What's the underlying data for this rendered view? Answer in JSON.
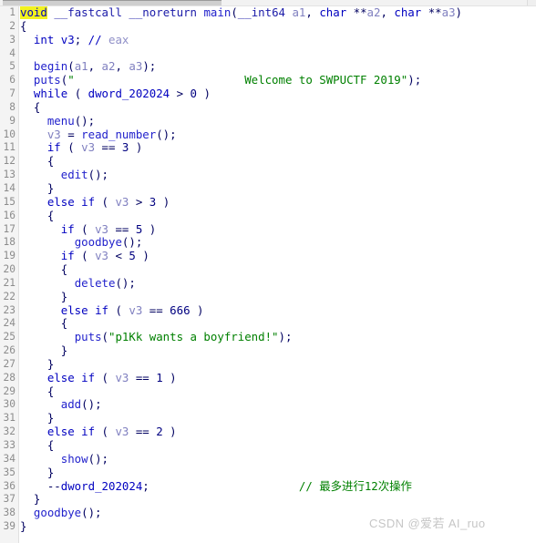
{
  "window": {
    "title": "IDA Pseudocode View",
    "background": "#ffffff"
  },
  "scrollbar": {
    "orientation": "horizontal",
    "thumb_label": "",
    "corner_label": ""
  },
  "colors": {
    "keyword": "#0000c0",
    "function": "#2222cc",
    "variable": "#8080c0",
    "string": "#008000",
    "comment": "#9090c8",
    "comment_green": "#008000",
    "highlight": "#f2f21e",
    "gutter_bg": "#f4f4f4",
    "line_number": "#8c8c8c",
    "watermark": "#c6c6c6"
  },
  "editor": {
    "first_line": 1,
    "last_line": 39,
    "total_lines": 39,
    "line_numbers": [
      1,
      2,
      3,
      4,
      5,
      6,
      7,
      8,
      9,
      10,
      11,
      12,
      13,
      14,
      15,
      16,
      17,
      18,
      19,
      20,
      21,
      22,
      23,
      24,
      25,
      26,
      27,
      28,
      29,
      30,
      31,
      32,
      33,
      34,
      35,
      36,
      37,
      38,
      39
    ],
    "highlighted_token": "void",
    "lines": [
      {
        "n": 1,
        "text": "void __fastcall __noreturn main(__int64 a1, char **a2, char **a3)",
        "tokens": [
          {
            "t": "void",
            "c": "hl-find"
          },
          {
            "t": " ",
            "c": "t-plain"
          },
          {
            "t": "__fastcall",
            "c": "t-kw2"
          },
          {
            "t": " ",
            "c": "t-plain"
          },
          {
            "t": "__noreturn",
            "c": "t-kw2"
          },
          {
            "t": " ",
            "c": "t-plain"
          },
          {
            "t": "main",
            "c": "t-fn"
          },
          {
            "t": "(",
            "c": "t-punc"
          },
          {
            "t": "__int64",
            "c": "t-kw2"
          },
          {
            "t": " ",
            "c": "t-plain"
          },
          {
            "t": "a1",
            "c": "t-var"
          },
          {
            "t": ", ",
            "c": "t-punc"
          },
          {
            "t": "char",
            "c": "t-kw"
          },
          {
            "t": " **",
            "c": "t-punc"
          },
          {
            "t": "a2",
            "c": "t-var"
          },
          {
            "t": ", ",
            "c": "t-punc"
          },
          {
            "t": "char",
            "c": "t-kw"
          },
          {
            "t": " **",
            "c": "t-punc"
          },
          {
            "t": "a3",
            "c": "t-var"
          },
          {
            "t": ")",
            "c": "t-punc"
          }
        ]
      },
      {
        "n": 2,
        "text": "{",
        "tokens": [
          {
            "t": "{",
            "c": "t-punc"
          }
        ]
      },
      {
        "n": 3,
        "text": "  int v3; // eax",
        "tokens": [
          {
            "t": "  ",
            "c": "t-plain"
          },
          {
            "t": "int",
            "c": "t-kw"
          },
          {
            "t": " ",
            "c": "t-plain"
          },
          {
            "t": "v3",
            "c": "t-kw"
          },
          {
            "t": "; ",
            "c": "t-punc"
          },
          {
            "t": "// ",
            "c": "t-kw"
          },
          {
            "t": "eax",
            "c": "t-cmt"
          }
        ]
      },
      {
        "n": 4,
        "text": "",
        "tokens": []
      },
      {
        "n": 5,
        "text": "  begin(a1, a2, a3);",
        "tokens": [
          {
            "t": "  ",
            "c": "t-plain"
          },
          {
            "t": "begin",
            "c": "t-fn"
          },
          {
            "t": "(",
            "c": "t-punc"
          },
          {
            "t": "a1",
            "c": "t-var"
          },
          {
            "t": ", ",
            "c": "t-punc"
          },
          {
            "t": "a2",
            "c": "t-var"
          },
          {
            "t": ", ",
            "c": "t-punc"
          },
          {
            "t": "a3",
            "c": "t-var"
          },
          {
            "t": ");",
            "c": "t-punc"
          }
        ]
      },
      {
        "n": 6,
        "text": "  puts(\"                         Welcome to SWPUCTF 2019\");",
        "tokens": [
          {
            "t": "  ",
            "c": "t-plain"
          },
          {
            "t": "puts",
            "c": "t-fn"
          },
          {
            "t": "(",
            "c": "t-punc"
          },
          {
            "t": "\"                         Welcome to SWPUCTF 2019\"",
            "c": "t-str"
          },
          {
            "t": ");",
            "c": "t-punc"
          }
        ]
      },
      {
        "n": 7,
        "text": "  while ( dword_202024 > 0 )",
        "tokens": [
          {
            "t": "  ",
            "c": "t-plain"
          },
          {
            "t": "while",
            "c": "t-kw"
          },
          {
            "t": " ( ",
            "c": "t-punc"
          },
          {
            "t": "dword_202024",
            "c": "t-kw"
          },
          {
            "t": " > ",
            "c": "t-punc"
          },
          {
            "t": "0",
            "c": "t-num"
          },
          {
            "t": " )",
            "c": "t-punc"
          }
        ]
      },
      {
        "n": 8,
        "text": "  {",
        "tokens": [
          {
            "t": "  {",
            "c": "t-punc"
          }
        ]
      },
      {
        "n": 9,
        "text": "    menu();",
        "tokens": [
          {
            "t": "    ",
            "c": "t-plain"
          },
          {
            "t": "menu",
            "c": "t-fn"
          },
          {
            "t": "();",
            "c": "t-punc"
          }
        ]
      },
      {
        "n": 10,
        "text": "    v3 = read_number();",
        "tokens": [
          {
            "t": "    ",
            "c": "t-plain"
          },
          {
            "t": "v3",
            "c": "t-var"
          },
          {
            "t": " = ",
            "c": "t-punc"
          },
          {
            "t": "read_number",
            "c": "t-fn"
          },
          {
            "t": "();",
            "c": "t-punc"
          }
        ]
      },
      {
        "n": 11,
        "text": "    if ( v3 == 3 )",
        "tokens": [
          {
            "t": "    ",
            "c": "t-plain"
          },
          {
            "t": "if",
            "c": "t-kw"
          },
          {
            "t": " ( ",
            "c": "t-punc"
          },
          {
            "t": "v3",
            "c": "t-var"
          },
          {
            "t": " == ",
            "c": "t-punc"
          },
          {
            "t": "3",
            "c": "t-num"
          },
          {
            "t": " )",
            "c": "t-punc"
          }
        ]
      },
      {
        "n": 12,
        "text": "    {",
        "tokens": [
          {
            "t": "    {",
            "c": "t-punc"
          }
        ]
      },
      {
        "n": 13,
        "text": "      edit();",
        "tokens": [
          {
            "t": "      ",
            "c": "t-plain"
          },
          {
            "t": "edit",
            "c": "t-fn"
          },
          {
            "t": "();",
            "c": "t-punc"
          }
        ]
      },
      {
        "n": 14,
        "text": "    }",
        "tokens": [
          {
            "t": "    }",
            "c": "t-punc"
          }
        ]
      },
      {
        "n": 15,
        "text": "    else if ( v3 > 3 )",
        "tokens": [
          {
            "t": "    ",
            "c": "t-plain"
          },
          {
            "t": "else",
            "c": "t-kw"
          },
          {
            "t": " ",
            "c": "t-plain"
          },
          {
            "t": "if",
            "c": "t-kw"
          },
          {
            "t": " ( ",
            "c": "t-punc"
          },
          {
            "t": "v3",
            "c": "t-var"
          },
          {
            "t": " > ",
            "c": "t-punc"
          },
          {
            "t": "3",
            "c": "t-num"
          },
          {
            "t": " )",
            "c": "t-punc"
          }
        ]
      },
      {
        "n": 16,
        "text": "    {",
        "tokens": [
          {
            "t": "    {",
            "c": "t-punc"
          }
        ]
      },
      {
        "n": 17,
        "text": "      if ( v3 == 5 )",
        "tokens": [
          {
            "t": "      ",
            "c": "t-plain"
          },
          {
            "t": "if",
            "c": "t-kw"
          },
          {
            "t": " ( ",
            "c": "t-punc"
          },
          {
            "t": "v3",
            "c": "t-var"
          },
          {
            "t": " == ",
            "c": "t-punc"
          },
          {
            "t": "5",
            "c": "t-num"
          },
          {
            "t": " )",
            "c": "t-punc"
          }
        ]
      },
      {
        "n": 18,
        "text": "        goodbye();",
        "tokens": [
          {
            "t": "        ",
            "c": "t-plain"
          },
          {
            "t": "goodbye",
            "c": "t-fn"
          },
          {
            "t": "();",
            "c": "t-punc"
          }
        ]
      },
      {
        "n": 19,
        "text": "      if ( v3 < 5 )",
        "tokens": [
          {
            "t": "      ",
            "c": "t-plain"
          },
          {
            "t": "if",
            "c": "t-kw"
          },
          {
            "t": " ( ",
            "c": "t-punc"
          },
          {
            "t": "v3",
            "c": "t-var"
          },
          {
            "t": " < ",
            "c": "t-punc"
          },
          {
            "t": "5",
            "c": "t-num"
          },
          {
            "t": " )",
            "c": "t-punc"
          }
        ]
      },
      {
        "n": 20,
        "text": "      {",
        "tokens": [
          {
            "t": "      {",
            "c": "t-punc"
          }
        ]
      },
      {
        "n": 21,
        "text": "        delete();",
        "tokens": [
          {
            "t": "        ",
            "c": "t-plain"
          },
          {
            "t": "delete",
            "c": "t-fn"
          },
          {
            "t": "();",
            "c": "t-punc"
          }
        ]
      },
      {
        "n": 22,
        "text": "      }",
        "tokens": [
          {
            "t": "      }",
            "c": "t-punc"
          }
        ]
      },
      {
        "n": 23,
        "text": "      else if ( v3 == 666 )",
        "tokens": [
          {
            "t": "      ",
            "c": "t-plain"
          },
          {
            "t": "else",
            "c": "t-kw"
          },
          {
            "t": " ",
            "c": "t-plain"
          },
          {
            "t": "if",
            "c": "t-kw"
          },
          {
            "t": " ( ",
            "c": "t-punc"
          },
          {
            "t": "v3",
            "c": "t-var"
          },
          {
            "t": " == ",
            "c": "t-punc"
          },
          {
            "t": "666",
            "c": "t-num"
          },
          {
            "t": " )",
            "c": "t-punc"
          }
        ]
      },
      {
        "n": 24,
        "text": "      {",
        "tokens": [
          {
            "t": "      {",
            "c": "t-punc"
          }
        ]
      },
      {
        "n": 25,
        "text": "        puts(\"p1Kk wants a boyfriend!\");",
        "tokens": [
          {
            "t": "        ",
            "c": "t-plain"
          },
          {
            "t": "puts",
            "c": "t-fn"
          },
          {
            "t": "(",
            "c": "t-punc"
          },
          {
            "t": "\"p1Kk wants a boyfriend!\"",
            "c": "t-str"
          },
          {
            "t": ");",
            "c": "t-punc"
          }
        ]
      },
      {
        "n": 26,
        "text": "      }",
        "tokens": [
          {
            "t": "      }",
            "c": "t-punc"
          }
        ]
      },
      {
        "n": 27,
        "text": "    }",
        "tokens": [
          {
            "t": "    }",
            "c": "t-punc"
          }
        ]
      },
      {
        "n": 28,
        "text": "    else if ( v3 == 1 )",
        "tokens": [
          {
            "t": "    ",
            "c": "t-plain"
          },
          {
            "t": "else",
            "c": "t-kw"
          },
          {
            "t": " ",
            "c": "t-plain"
          },
          {
            "t": "if",
            "c": "t-kw"
          },
          {
            "t": " ( ",
            "c": "t-punc"
          },
          {
            "t": "v3",
            "c": "t-var"
          },
          {
            "t": " == ",
            "c": "t-punc"
          },
          {
            "t": "1",
            "c": "t-num"
          },
          {
            "t": " )",
            "c": "t-punc"
          }
        ]
      },
      {
        "n": 29,
        "text": "    {",
        "tokens": [
          {
            "t": "    {",
            "c": "t-punc"
          }
        ]
      },
      {
        "n": 30,
        "text": "      add();",
        "tokens": [
          {
            "t": "      ",
            "c": "t-plain"
          },
          {
            "t": "add",
            "c": "t-fn"
          },
          {
            "t": "();",
            "c": "t-punc"
          }
        ]
      },
      {
        "n": 31,
        "text": "    }",
        "tokens": [
          {
            "t": "    }",
            "c": "t-punc"
          }
        ]
      },
      {
        "n": 32,
        "text": "    else if ( v3 == 2 )",
        "tokens": [
          {
            "t": "    ",
            "c": "t-plain"
          },
          {
            "t": "else",
            "c": "t-kw"
          },
          {
            "t": " ",
            "c": "t-plain"
          },
          {
            "t": "if",
            "c": "t-kw"
          },
          {
            "t": " ( ",
            "c": "t-punc"
          },
          {
            "t": "v3",
            "c": "t-var"
          },
          {
            "t": " == ",
            "c": "t-punc"
          },
          {
            "t": "2",
            "c": "t-num"
          },
          {
            "t": " )",
            "c": "t-punc"
          }
        ]
      },
      {
        "n": 33,
        "text": "    {",
        "tokens": [
          {
            "t": "    {",
            "c": "t-punc"
          }
        ]
      },
      {
        "n": 34,
        "text": "      show();",
        "tokens": [
          {
            "t": "      ",
            "c": "t-plain"
          },
          {
            "t": "show",
            "c": "t-fn"
          },
          {
            "t": "();",
            "c": "t-punc"
          }
        ]
      },
      {
        "n": 35,
        "text": "    }",
        "tokens": [
          {
            "t": "    }",
            "c": "t-punc"
          }
        ]
      },
      {
        "n": 36,
        "text": "    --dword_202024;                     // 最多进行12次操作",
        "tokens": [
          {
            "t": "    ",
            "c": "t-plain"
          },
          {
            "t": "--",
            "c": "t-punc"
          },
          {
            "t": "dword_202024",
            "c": "t-kw"
          },
          {
            "t": ";",
            "c": "t-punc"
          },
          {
            "t": "                      ",
            "c": "t-plain"
          },
          {
            "t": "// 最多进行12次操作",
            "c": "t-cmt2"
          }
        ]
      },
      {
        "n": 37,
        "text": "  }",
        "tokens": [
          {
            "t": "  }",
            "c": "t-punc"
          }
        ]
      },
      {
        "n": 38,
        "text": "  goodbye();",
        "tokens": [
          {
            "t": "  ",
            "c": "t-plain"
          },
          {
            "t": "goodbye",
            "c": "t-fn"
          },
          {
            "t": "();",
            "c": "t-punc"
          }
        ]
      },
      {
        "n": 39,
        "text": "}",
        "tokens": [
          {
            "t": "}",
            "c": "t-punc"
          }
        ]
      }
    ]
  },
  "watermark": {
    "text": "CSDN @爱若 AI_ruo"
  }
}
